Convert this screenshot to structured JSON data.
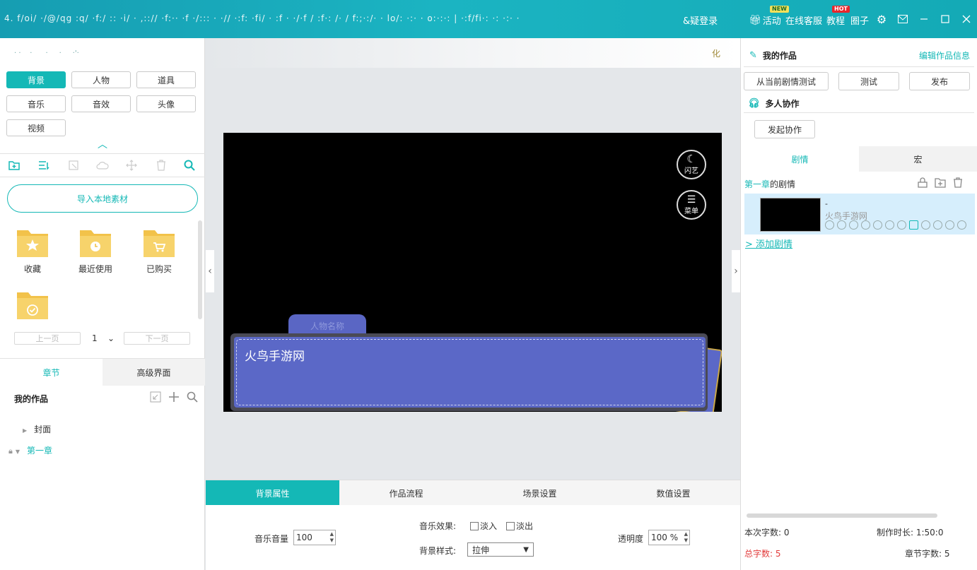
{
  "titlebar": {
    "blurred_title": "4. f/oi/ ·/@/qg :q/ ·f:/ :: ·i/ · ,::// ·f:·· ·f ·/::: · ·// ·:f: ·fi/ · :f · ·/·f / :f·: /· / f:;·:/· · lo/: ·:· · o:·:·: | ·:f/fi·: ·: ·:· ·",
    "login": "&疑登录",
    "activity": "活动",
    "service": "在线客服",
    "tutorial": "教程",
    "circle": "圈子",
    "badge_new": "NEW",
    "badge_hot": "HOT"
  },
  "left": {
    "top_text": "· ·    ·      ·     ·     ·'·",
    "categories": [
      "背景",
      "人物",
      "道具",
      "音乐",
      "音效",
      "头像",
      "视频"
    ],
    "import_button": "导入本地素材",
    "folders": [
      "收藏",
      "最近使用",
      "已购买",
      ""
    ],
    "pager": {
      "prev": "上一页",
      "page": "1",
      "next": "下一页"
    },
    "tabs": [
      "章节",
      "高级界面"
    ],
    "tree_title": "我的作品",
    "tree_items": [
      "封面",
      "第一章"
    ]
  },
  "canvas": {
    "top_hint": "化",
    "btn_flash": "闪艺",
    "btn_menu": "菜单",
    "dialog_tab": "人物名称",
    "dialog_text": "火鸟手游网"
  },
  "bottom": {
    "tabs": [
      "背景属性",
      "作品流程",
      "场景设置",
      "数值设置"
    ],
    "music_volume_label": "音乐音量",
    "music_volume_value": "100",
    "music_effect_label": "音乐效果:",
    "fade_in": "淡入",
    "fade_out": "淡出",
    "bg_style_label": "背景样式:",
    "bg_style_value": "拉伸",
    "opacity_label": "透明度",
    "opacity_value": "100 %"
  },
  "right": {
    "title": "我的作品",
    "edit_link": "编辑作品信息",
    "btn_test_from": "从当前剧情测试",
    "btn_test": "测试",
    "btn_publish": "发布",
    "collab_title": "多人协作",
    "btn_collab": "发起协作",
    "tabs": [
      "剧情",
      "宏"
    ],
    "chapter_plot_prefix": "第一章",
    "chapter_plot_suffix": "的剧情",
    "plot_dash": "-",
    "plot_name": "火鸟手游网",
    "add_plot": "> 添加剧情",
    "stat_words": "本次字数:  0",
    "stat_time": "制作时长:  1:50:0",
    "stat_total": "总字数:  5",
    "stat_chapter": "章节字数:  5"
  },
  "colors": {
    "accent": "#14b8b6",
    "dialog": "#5b68c7",
    "red": "#e23b3b"
  }
}
